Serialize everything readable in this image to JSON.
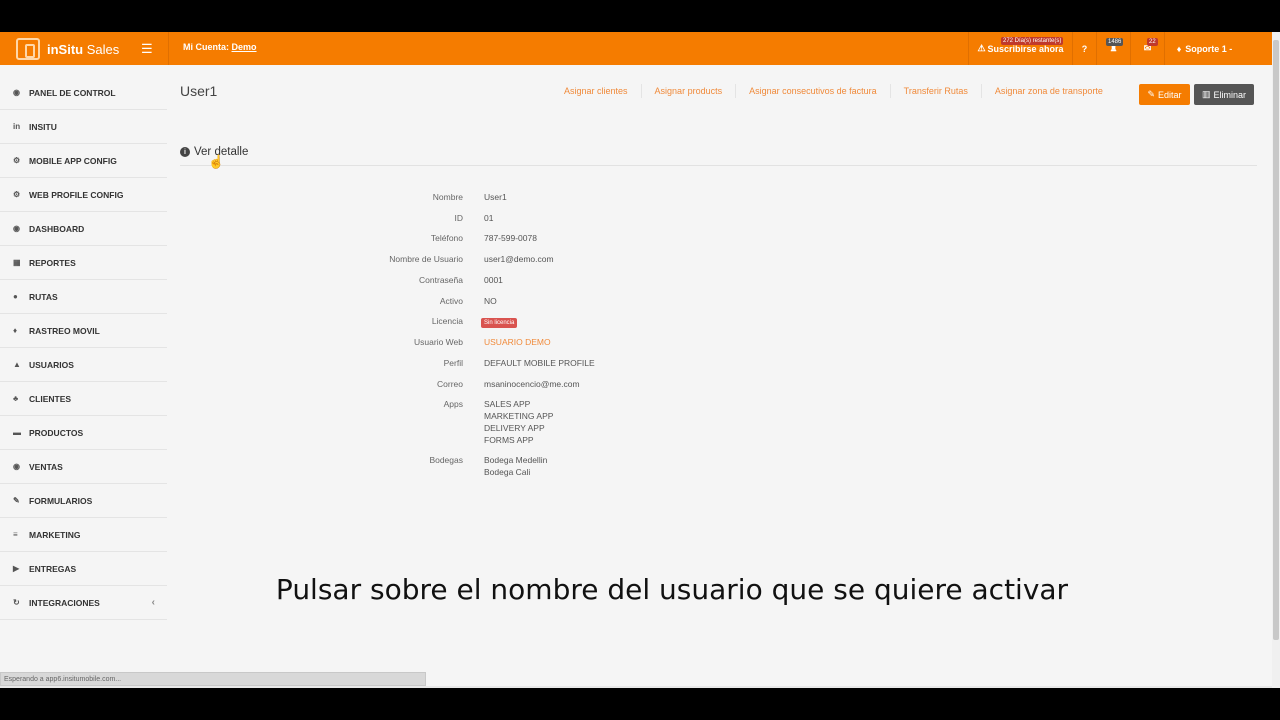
{
  "topbar": {
    "brand_bold": "inSitu",
    "brand_light": " Sales",
    "account_label": "Mi Cuenta:",
    "account_name": "Demo",
    "subscribe_label": "Suscribirse ahora",
    "trial_days": "272 Día(s) restante(s)",
    "notif_count": "1486",
    "mail_count": "22",
    "support_label": "Soporte 1 -"
  },
  "sidebar": {
    "items": [
      {
        "label": "PANEL DE CONTROL",
        "icon": "dashboard-icon"
      },
      {
        "label": "INSITU",
        "icon": "linkedin-icon"
      },
      {
        "label": "MOBILE APP CONFIG",
        "icon": "cogs-icon"
      },
      {
        "label": "WEB PROFILE CONFIG",
        "icon": "cogs-icon"
      },
      {
        "label": "DASHBOARD",
        "icon": "dashboard-icon"
      },
      {
        "label": "REPORTES",
        "icon": "chart-icon"
      },
      {
        "label": "RUTAS",
        "icon": "globe-icon"
      },
      {
        "label": "RASTREO MOVIL",
        "icon": "map-marker-icon"
      },
      {
        "label": "USUARIOS",
        "icon": "user-icon"
      },
      {
        "label": "CLIENTES",
        "icon": "users-icon"
      },
      {
        "label": "PRODUCTOS",
        "icon": "briefcase-icon"
      },
      {
        "label": "VENTAS",
        "icon": "dashboard-icon"
      },
      {
        "label": "FORMULARIOS",
        "icon": "edit-icon"
      },
      {
        "label": "MARKETING",
        "icon": "list-icon"
      },
      {
        "label": "ENTREGAS",
        "icon": "truck-icon"
      },
      {
        "label": "INTEGRACIONES",
        "icon": "refresh-icon"
      }
    ]
  },
  "main": {
    "title": "User1",
    "actions": [
      "Asignar clientes",
      "Asignar products",
      "Asignar consecutivos de factura",
      "Transferir Rutas",
      "Asignar zona de transporte"
    ],
    "edit_label": "Editar",
    "delete_label": "Eliminar",
    "section_label": "Ver detalle"
  },
  "details": {
    "nombre_label": "Nombre",
    "nombre": "User1",
    "id_label": "ID",
    "id": "01",
    "telefono_label": "Teléfono",
    "telefono": "787-599-0078",
    "usuario_label": "Nombre de Usuario",
    "usuario": "user1@demo.com",
    "contrasena_label": "Contraseña",
    "contrasena": "0001",
    "activo_label": "Activo",
    "activo": "NO",
    "licencia_label": "Licencia",
    "licencia": "Sin licencia",
    "usuario_web_label": "Usuario Web",
    "usuario_web": "USUARIO DEMO",
    "perfil_label": "Perfil",
    "perfil": "DEFAULT MOBILE PROFILE",
    "correo_label": "Correo",
    "correo": "msaninocencio@me.com",
    "apps_label": "Apps",
    "apps": [
      "SALES APP",
      "MARKETING APP",
      "DELIVERY APP",
      "FORMS APP"
    ],
    "bodegas_label": "Bodegas",
    "bodegas": [
      "Bodega Medellin",
      "Bodega Cali"
    ]
  },
  "caption": "Pulsar sobre el nombre del usuario que se quiere activar",
  "status": "Esperando a app6.insitumobile.com..."
}
